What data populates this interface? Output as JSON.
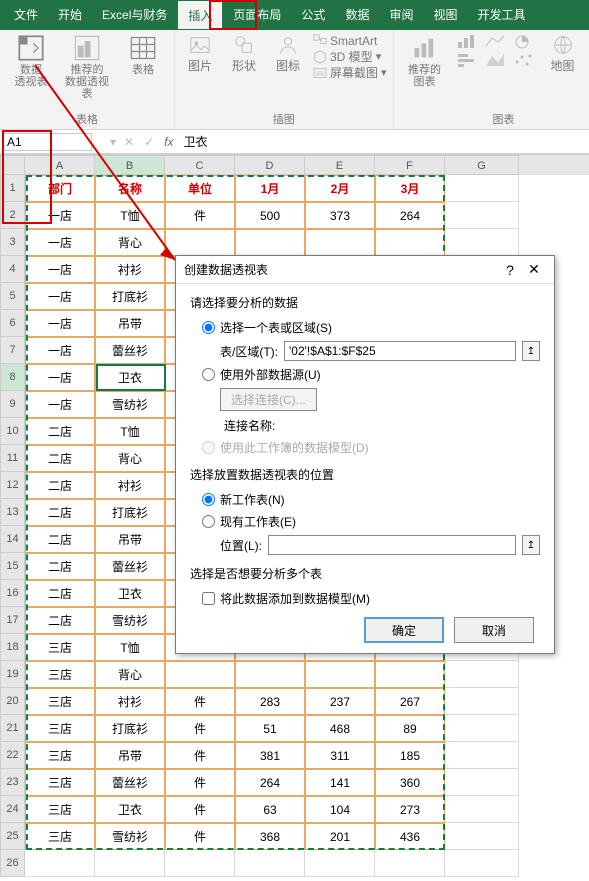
{
  "ribbon": {
    "tabs": [
      "文件",
      "开始",
      "Excel与财务",
      "插入",
      "页面布局",
      "公式",
      "数据",
      "审阅",
      "视图",
      "开发工具"
    ],
    "active_tab_idx": 3,
    "groups": {
      "tables": {
        "pivot": "数据\n透视表",
        "recommend": "推荐的\n数据透视表",
        "table": "表格",
        "label": "表格"
      },
      "illus": {
        "picture": "图片",
        "shapes": "形状",
        "icons": "图标",
        "smartart": "SmartArt",
        "model3d": "3D 模型",
        "screenshot": "屏幕截图",
        "label": "插图"
      },
      "charts": {
        "recommend": "推荐的\n图表",
        "maps": "地图",
        "label": "图表"
      }
    }
  },
  "formula_bar": {
    "namebox": "A1",
    "fx": "fx",
    "value": "卫衣"
  },
  "sheet": {
    "columns": [
      "A",
      "B",
      "C",
      "D",
      "E",
      "F",
      "G"
    ],
    "headers": [
      "部门",
      "名称",
      "单位",
      "1月",
      "2月",
      "3月"
    ],
    "rows": [
      [
        "一店",
        "T恤",
        "件",
        "500",
        "373",
        "264"
      ],
      [
        "一店",
        "背心",
        "",
        "",
        "",
        ""
      ],
      [
        "一店",
        "衬衫",
        "",
        "",
        "",
        ""
      ],
      [
        "一店",
        "打底衫",
        "",
        "",
        "",
        ""
      ],
      [
        "一店",
        "吊带",
        "",
        "",
        "",
        ""
      ],
      [
        "一店",
        "蕾丝衫",
        "",
        "",
        "",
        ""
      ],
      [
        "一店",
        "卫衣",
        "",
        "",
        "",
        ""
      ],
      [
        "一店",
        "雪纺衫",
        "",
        "",
        "",
        ""
      ],
      [
        "二店",
        "T恤",
        "",
        "",
        "",
        ""
      ],
      [
        "二店",
        "背心",
        "",
        "",
        "",
        ""
      ],
      [
        "二店",
        "衬衫",
        "",
        "",
        "",
        ""
      ],
      [
        "二店",
        "打底衫",
        "",
        "",
        "",
        ""
      ],
      [
        "二店",
        "吊带",
        "",
        "",
        "",
        ""
      ],
      [
        "二店",
        "蕾丝衫",
        "",
        "",
        "",
        ""
      ],
      [
        "二店",
        "卫衣",
        "",
        "",
        "",
        ""
      ],
      [
        "二店",
        "雪纺衫",
        "",
        "",
        "",
        ""
      ],
      [
        "三店",
        "T恤",
        "",
        "",
        "",
        ""
      ],
      [
        "三店",
        "背心",
        "",
        "",
        "",
        ""
      ],
      [
        "三店",
        "衬衫",
        "件",
        "283",
        "237",
        "267"
      ],
      [
        "三店",
        "打底衫",
        "件",
        "51",
        "468",
        "89"
      ],
      [
        "三店",
        "吊带",
        "件",
        "381",
        "311",
        "185"
      ],
      [
        "三店",
        "蕾丝衫",
        "件",
        "264",
        "141",
        "360"
      ],
      [
        "三店",
        "卫衣",
        "件",
        "63",
        "104",
        "273"
      ],
      [
        "三店",
        "雪纺衫",
        "件",
        "368",
        "201",
        "436"
      ]
    ],
    "last_empty_row": 26
  },
  "dialog": {
    "title": "创建数据透视表",
    "section1_h": "请选择要分析的数据",
    "opt_table": "选择一个表或区域(S)",
    "ref_label": "表/区域(T):",
    "ref_value": "'02'!$A$1:$F$25",
    "opt_external": "使用外部数据源(U)",
    "choose_conn": "选择连接(C)...",
    "conn_name_lbl": "连接名称:",
    "opt_model": "使用此工作簿的数据模型(D)",
    "section2_h": "选择放置数据透视表的位置",
    "opt_newsheet": "新工作表(N)",
    "opt_existsheet": "现有工作表(E)",
    "loc_label": "位置(L):",
    "section3_h": "选择是否想要分析多个表",
    "chk_addmodel": "将此数据添加到数据模型(M)",
    "ok": "确定",
    "cancel": "取消"
  }
}
